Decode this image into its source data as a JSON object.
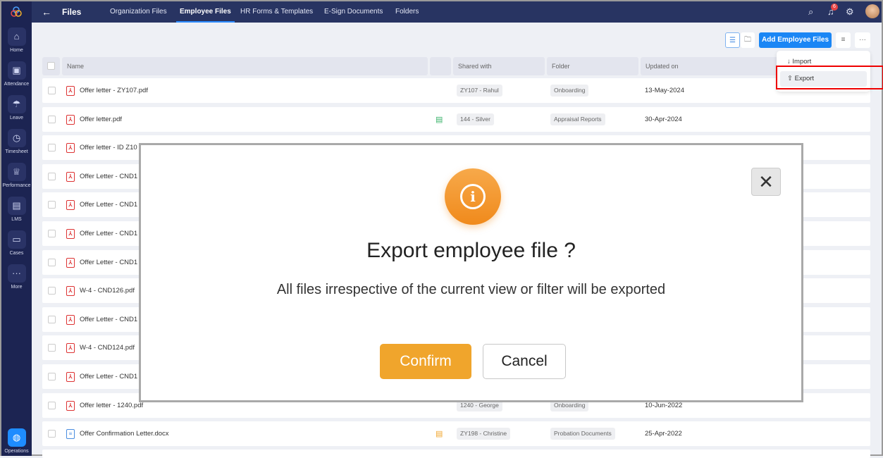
{
  "sidebar": {
    "items": [
      {
        "label": "Home",
        "icon": "⌂"
      },
      {
        "label": "Attendance",
        "icon": "▣"
      },
      {
        "label": "Leave",
        "icon": "☂"
      },
      {
        "label": "Timesheet",
        "icon": "◷"
      },
      {
        "label": "Performance",
        "icon": "♕"
      },
      {
        "label": "LMS",
        "icon": "▤"
      },
      {
        "label": "Cases",
        "icon": "▭"
      },
      {
        "label": "More",
        "icon": "···"
      }
    ],
    "bottom": {
      "label": "Operations",
      "icon": "◍"
    }
  },
  "header": {
    "title": "Files",
    "tabs": [
      "Organization Files",
      "Employee Files",
      "HR Forms & Templates",
      "E-Sign Documents",
      "Folders"
    ],
    "active_tab": "Employee Files",
    "notification_count": "6"
  },
  "toolbar": {
    "add_label": "Add Employee Files",
    "more": "···"
  },
  "menu": {
    "import": "Import",
    "export": "Export"
  },
  "table": {
    "columns": [
      "Name",
      "",
      "Shared with",
      "Folder",
      "Updated on"
    ],
    "rows": [
      {
        "name": "Offer letter - ZY107.pdf",
        "type": "pdf",
        "shared": "ZY107 - Rahul",
        "folder": "Onboarding",
        "date": "13-May-2024"
      },
      {
        "name": "Offer letter.pdf",
        "type": "pdf",
        "status": "green",
        "shared": "144 - Silver",
        "folder": "Appraisal Reports",
        "date": "30-Apr-2024"
      },
      {
        "name": "Offer letter - ID Z10",
        "type": "pdf"
      },
      {
        "name": "Offer Letter - CND1",
        "type": "pdf"
      },
      {
        "name": "Offer Letter - CND1",
        "type": "pdf"
      },
      {
        "name": "Offer Letter - CND1",
        "type": "pdf"
      },
      {
        "name": "Offer Letter - CND1",
        "type": "pdf"
      },
      {
        "name": "W-4 - CND126.pdf",
        "type": "pdf"
      },
      {
        "name": "Offer Letter - CND1",
        "type": "pdf"
      },
      {
        "name": "W-4 - CND124.pdf",
        "type": "pdf"
      },
      {
        "name": "Offer Letter - CND1",
        "type": "pdf"
      },
      {
        "name": "Offer letter - 1240.pdf",
        "type": "pdf",
        "shared": "1240 - George",
        "folder": "Onboarding",
        "date": "10-Jun-2022"
      },
      {
        "name": "Offer Confirmation Letter.docx",
        "type": "doc",
        "status": "orange",
        "shared": "ZY198 - Christine",
        "folder": "Probation Documents",
        "date": "25-Apr-2022"
      }
    ]
  },
  "modal": {
    "title": "Export employee file ?",
    "message": "All files irrespective of the current view or filter will be exported",
    "confirm": "Confirm",
    "cancel": "Cancel",
    "close": "✕",
    "icon": "i"
  },
  "colors": {
    "accent": "#1a86f5",
    "confirm": "#f0a52c",
    "sidebar": "#1c2452",
    "highlight": "#e00000"
  }
}
